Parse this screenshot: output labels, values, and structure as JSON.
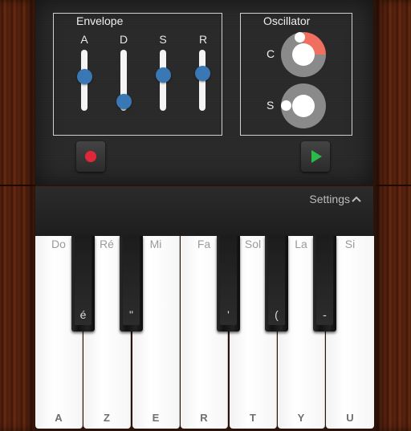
{
  "envelope": {
    "title": "Envelope",
    "faders": [
      {
        "label": "A",
        "level": 0.57
      },
      {
        "label": "D",
        "level": 0.1
      },
      {
        "label": "S",
        "level": 0.6
      },
      {
        "label": "R",
        "level": 0.63
      }
    ]
  },
  "oscillator": {
    "title": "Oscillator",
    "dials": [
      {
        "label": "C",
        "level": 0.1
      },
      {
        "label": "S",
        "level": 0.0
      }
    ]
  },
  "transport": {
    "record": "record-icon",
    "play": "play-icon"
  },
  "settings_label": "Settings",
  "colors": {
    "accent": "#3a78b5",
    "record": "#e0283a",
    "play": "#2bbb4a",
    "dial_active": "#f07060"
  },
  "keyboard": {
    "white_keys": [
      {
        "note": "Do",
        "key": "A"
      },
      {
        "note": "Ré",
        "key": "Z"
      },
      {
        "note": "Mi",
        "key": "E"
      },
      {
        "note": "Fa",
        "key": "R"
      },
      {
        "note": "Sol",
        "key": "T"
      },
      {
        "note": "La",
        "key": "Y"
      },
      {
        "note": "Si",
        "key": "U"
      }
    ],
    "black_keys": [
      {
        "key": "é"
      },
      {
        "key": "\""
      },
      {
        "key": "'"
      },
      {
        "key": "("
      },
      {
        "key": "-"
      }
    ]
  }
}
